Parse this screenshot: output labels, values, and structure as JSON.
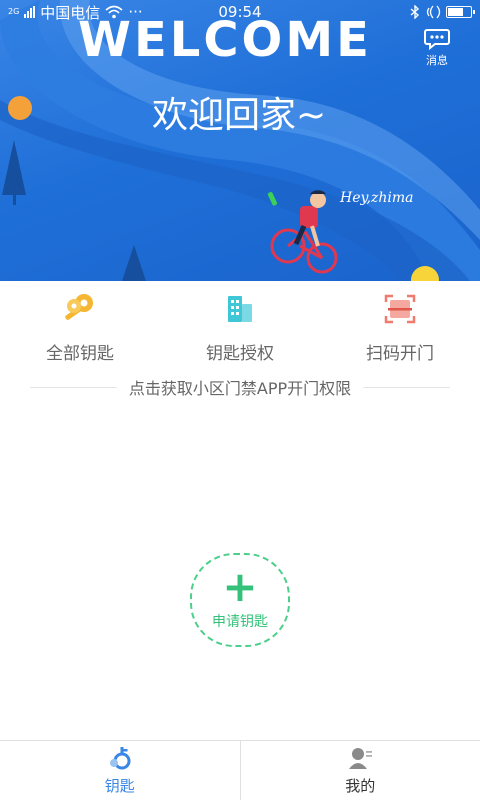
{
  "status_bar": {
    "network_type": "2G",
    "carrier": "中国电信",
    "more": "···",
    "time": "09:54"
  },
  "hero": {
    "title": "WELCOME",
    "greeting": "欢迎回家~",
    "caption": "Hey,zhima",
    "message_label": "消息"
  },
  "actions": [
    {
      "label": "全部钥匙",
      "icon": "keys-icon",
      "color": "#f5b731"
    },
    {
      "label": "钥匙授权",
      "icon": "building-icon",
      "color": "#3fc7d8"
    },
    {
      "label": "扫码开门",
      "icon": "scan-icon",
      "color": "#f07a6e"
    }
  ],
  "hint": "点击获取小区门禁APP开门权限",
  "apply_button": {
    "label": "申请钥匙",
    "color": "#34c27a"
  },
  "tabs": [
    {
      "label": "钥匙",
      "icon": "key-tab-icon",
      "active": true
    },
    {
      "label": "我的",
      "icon": "profile-icon",
      "active": false
    }
  ],
  "colors": {
    "accent_blue": "#3a86e6",
    "accent_green": "#34c27a"
  }
}
